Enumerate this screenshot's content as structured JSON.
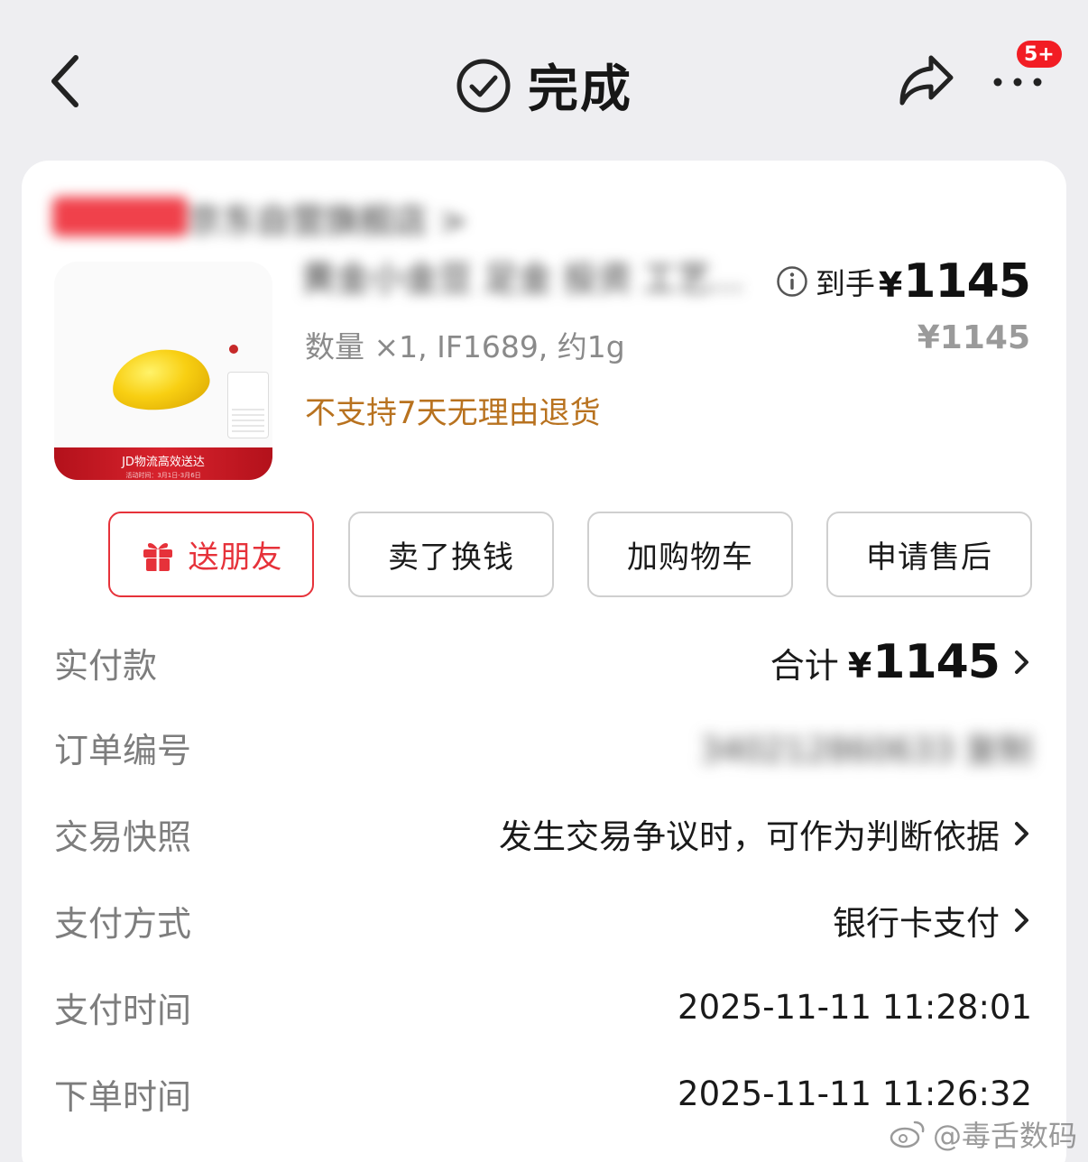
{
  "header": {
    "title": "完成",
    "badge": "5+"
  },
  "shop": {
    "name": "京东自营旗舰店 >"
  },
  "product": {
    "name": "黄金小金豆 足金 投资 工艺...",
    "spec": "数量 ×1, IF1689, 约1g",
    "notice": "不支持7天无理由退货",
    "price_label": "到手",
    "currency": "¥",
    "price": "1145",
    "original_price": "¥1145",
    "image_banner": "JD物流高效送达",
    "image_banner_sub": "活动时间：3月1日-3月6日"
  },
  "actions": {
    "gift": "送朋友",
    "sell": "卖了换钱",
    "cart": "加购物车",
    "after_sale": "申请售后"
  },
  "details": {
    "paid": {
      "label": "实付款",
      "prefix": "合计",
      "currency": "¥",
      "amount": "1145"
    },
    "order_no": {
      "label": "订单编号",
      "value": "340212860633 复制"
    },
    "snapshot": {
      "label": "交易快照",
      "value": "发生交易争议时，可作为判断依据"
    },
    "pay_method": {
      "label": "支付方式",
      "value": "银行卡支付"
    },
    "pay_time": {
      "label": "支付时间",
      "value": "2025-11-11 11:28:01"
    },
    "order_time": {
      "label": "下单时间",
      "value": "2025-11-11 11:26:32"
    }
  },
  "watermark": "@毒舌数码",
  "colors": {
    "accent_red": "#e6323a",
    "notice_orange": "#b8721f",
    "background": "#eeeef1"
  },
  "icons": [
    "back-arrow-icon",
    "check-circle-icon",
    "share-icon",
    "more-dots-icon",
    "info-icon",
    "gift-icon",
    "chevron-right-icon",
    "weibo-icon"
  ]
}
